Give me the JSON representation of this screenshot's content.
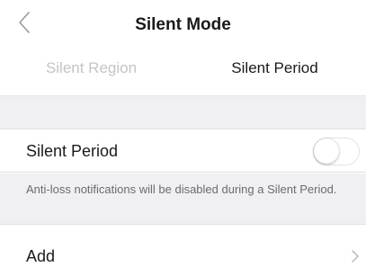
{
  "nav": {
    "title": "Silent Mode",
    "back_icon": "chevron-left-icon"
  },
  "tabs": [
    {
      "label": "Silent Region",
      "active": false
    },
    {
      "label": "Silent Period",
      "active": true
    }
  ],
  "accent_color": "#26c6b0",
  "silent_period_row": {
    "label": "Silent Period",
    "enabled": false
  },
  "info": {
    "text": "Anti-loss notifications will be disabled during a Silent Period."
  },
  "add_row": {
    "label": "Add",
    "chevron_icon": "chevron-right-icon"
  }
}
